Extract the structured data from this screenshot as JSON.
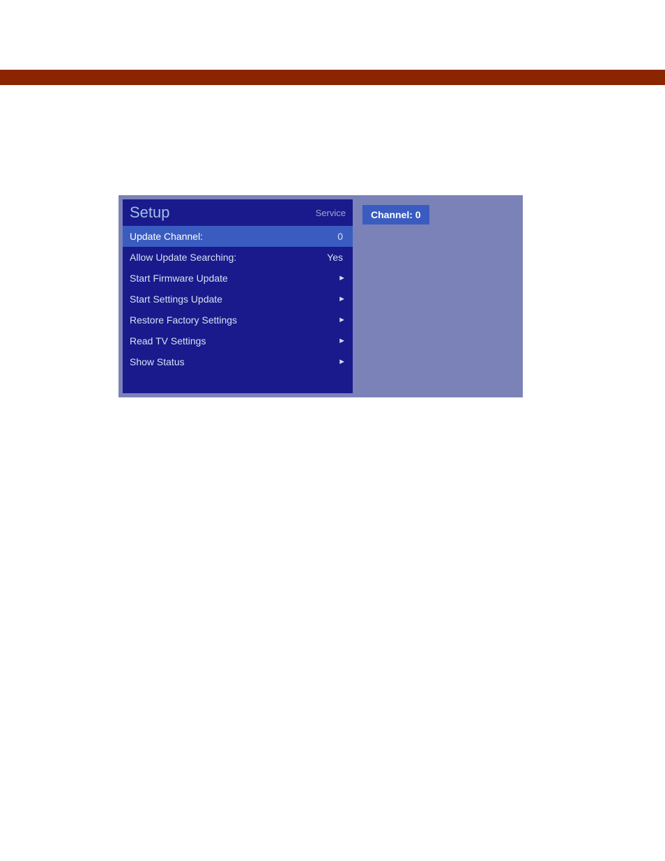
{
  "topbar": {
    "color": "#8B2500"
  },
  "menu": {
    "title": "Setup",
    "subtitle": "Service",
    "items": [
      {
        "label": "Update Channel:",
        "value": "0",
        "arrow": false,
        "highlighted": true
      },
      {
        "label": "Allow Update Searching:",
        "value": "Yes",
        "arrow": false,
        "highlighted": false
      },
      {
        "label": "Start Firmware Update",
        "value": "",
        "arrow": true,
        "highlighted": false
      },
      {
        "label": "Start Settings Update",
        "value": "",
        "arrow": true,
        "highlighted": false
      },
      {
        "label": "Restore Factory Settings",
        "value": "",
        "arrow": true,
        "highlighted": false
      },
      {
        "label": "Read TV Settings",
        "value": "",
        "arrow": true,
        "highlighted": false
      },
      {
        "label": "Show Status",
        "value": "",
        "arrow": true,
        "highlighted": false
      }
    ]
  },
  "sidepanel": {
    "channel_label": "Channel: 0"
  }
}
